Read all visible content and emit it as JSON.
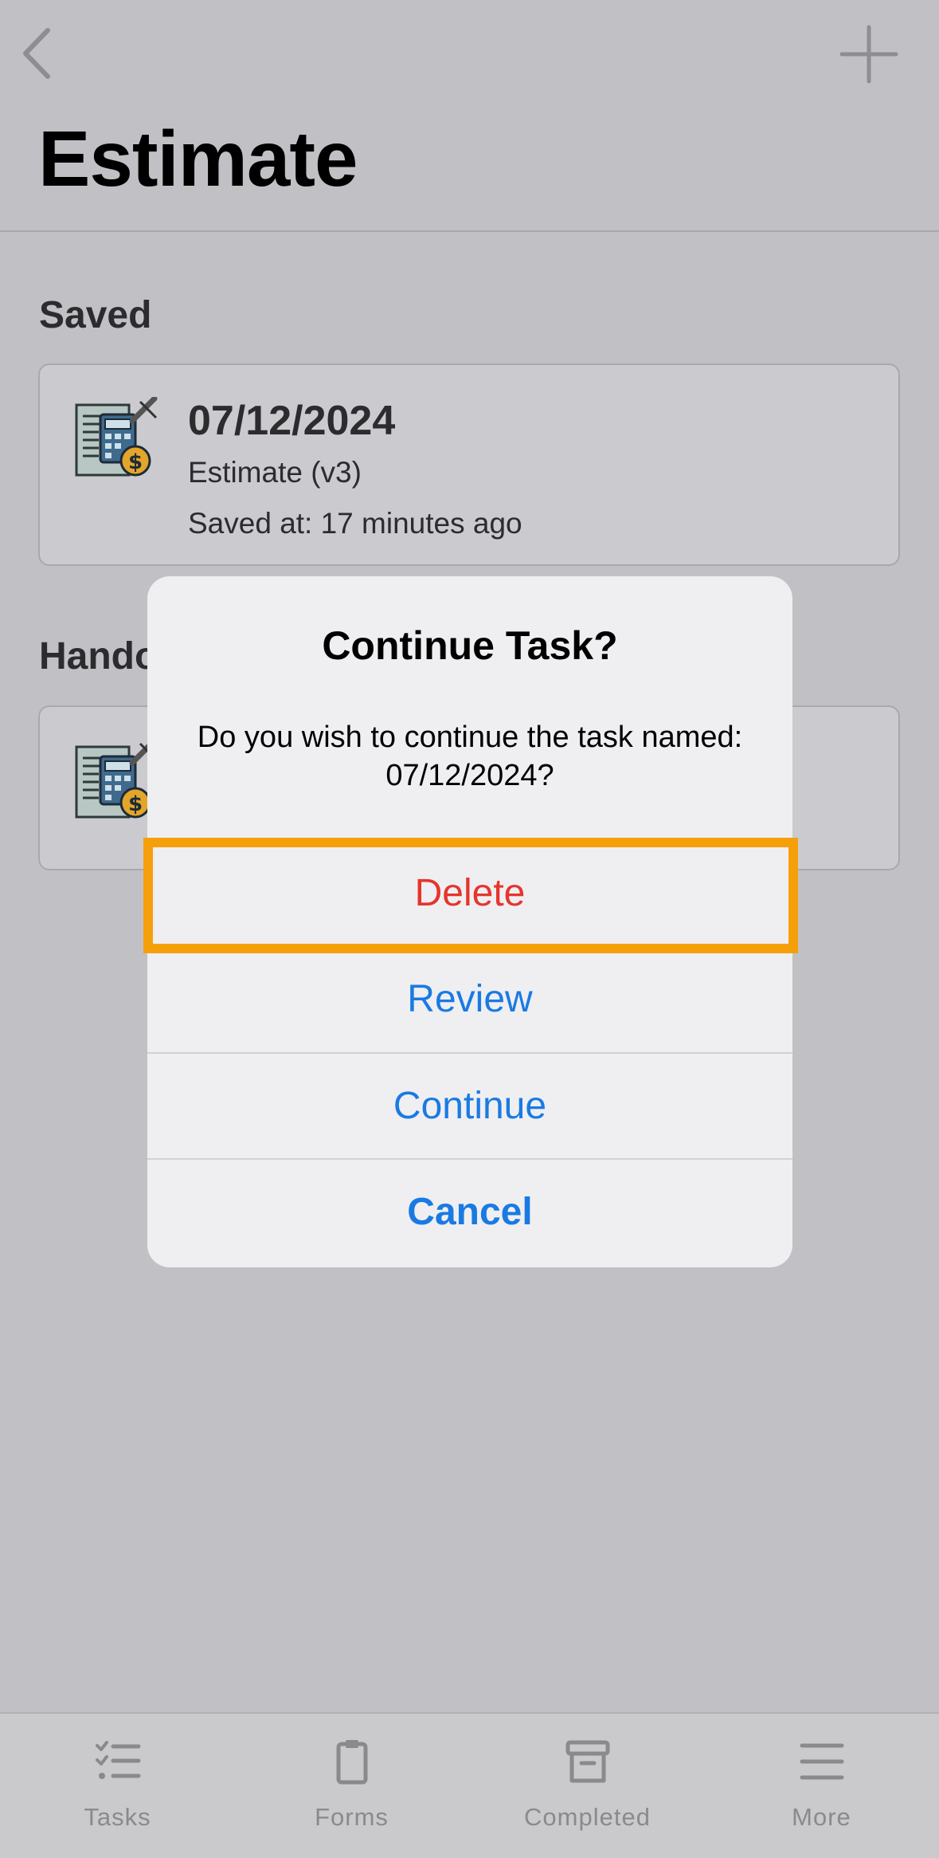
{
  "header": {
    "title": "Estimate"
  },
  "sections": {
    "saved": {
      "title": "Saved",
      "card": {
        "date": "07/12/2024",
        "name": "Estimate (v3)",
        "saved_at": "Saved at: 17 minutes ago"
      }
    },
    "handed": {
      "title_visible": "Hando"
    }
  },
  "alert": {
    "title": "Continue Task?",
    "message": "Do you wish to continue the task named: 07/12/2024?",
    "buttons": {
      "delete": "Delete",
      "review": "Review",
      "continue": "Continue",
      "cancel": "Cancel"
    }
  },
  "tab_bar": {
    "tasks": "Tasks",
    "forms": "Forms",
    "completed": "Completed",
    "more": "More"
  },
  "colors": {
    "accent_blue": "#1a7ae3",
    "destructive_red": "#e5352d",
    "highlight_orange": "#f5a00b"
  }
}
